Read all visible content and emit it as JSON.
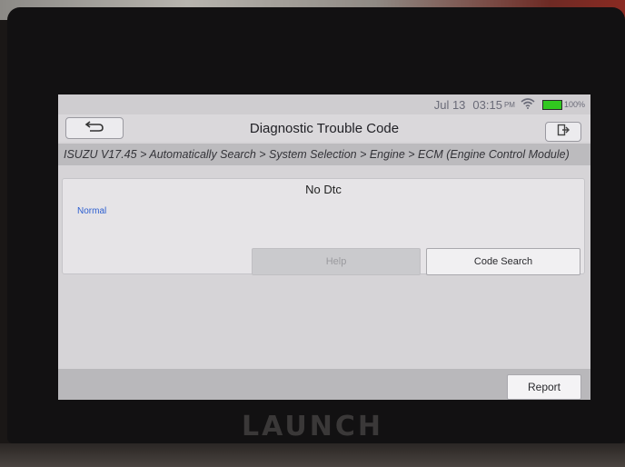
{
  "status_bar": {
    "date": "Jul 13",
    "time": "03:15",
    "ampm": "PM",
    "wifi_icon": "wifi-icon",
    "battery_percent": "100%",
    "battery_color": "#31c81f"
  },
  "header": {
    "title": "Diagnostic Trouble Code",
    "back_icon": "back-arrow-icon",
    "exit_icon": "exit-icon"
  },
  "breadcrumb": "ISUZU V17.45 > Automatically Search > System Selection > Engine > ECM (Engine Control Module)",
  "dtc": {
    "heading": "No Dtc",
    "status": "Normal",
    "status_color": "#2d5fd0"
  },
  "actions": {
    "help_label": "Help",
    "code_search_label": "Code Search",
    "report_label": "Report"
  },
  "device": {
    "brand": "LAUNCH"
  }
}
